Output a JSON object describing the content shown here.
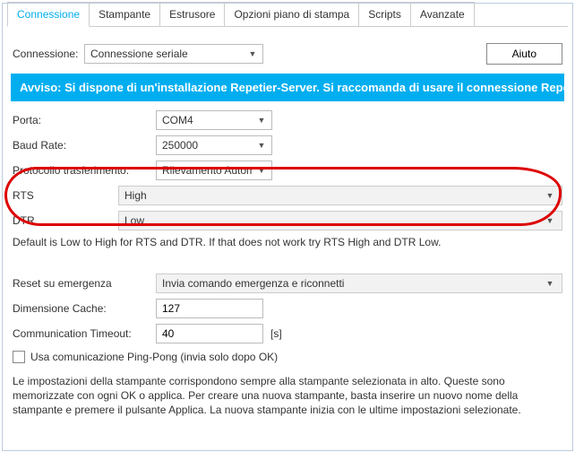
{
  "tabs": {
    "t0": "Connessione",
    "t1": "Stampante",
    "t2": "Estrusore",
    "t3": "Opzioni piano di stampa",
    "t4": "Scripts",
    "t5": "Avanzate"
  },
  "conn": {
    "label": "Connessione:",
    "value": "Connessione seriale",
    "help_btn": "Aiuto"
  },
  "banner": "Avviso: Si dispone di un'installazione Repetier-Server. Si raccomanda di usare il connessione Repetier-Server",
  "fields": {
    "port_label": "Porta:",
    "port_value": "COM4",
    "baud_label": "Baud Rate:",
    "baud_value": "250000",
    "proto_label": "Protocollo trasferimento:",
    "proto_value": "Rilevamento Automatico",
    "rts_label": "RTS",
    "rts_value": "High",
    "dtr_label": "DTR",
    "dtr_value": "Low",
    "default_note": "Default is Low to High for RTS and DTR. If that does not work try RTS High and DTR Low.",
    "reset_label": "Reset su emergenza",
    "reset_value": "Invia comando emergenza e riconnetti",
    "cache_label": "Dimensione Cache:",
    "cache_value": "127",
    "timeout_label": "Communication Timeout:",
    "timeout_value": "40",
    "timeout_unit": "[s]",
    "pingpong_label": "Usa comunicazione Ping-Pong (invia solo dopo OK)"
  },
  "description": "Le impostazioni della stampante corrispondono sempre alla stampante selezionata in alto. Queste sono memorizzate con ogni OK o applica. Per creare una nuova stampante, basta inserire un nuovo nome della stampante e premere il pulsante Applica. La nuova stampante inizia con le ultime impostazioni selezionate."
}
